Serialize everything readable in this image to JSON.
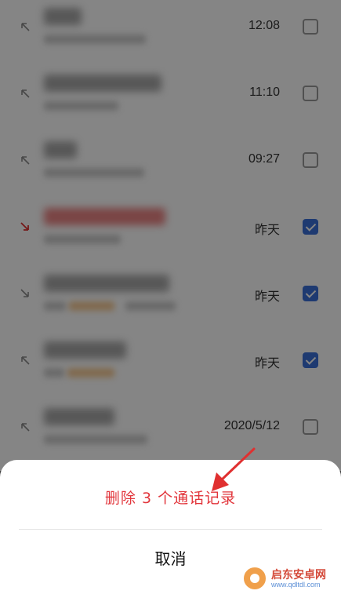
{
  "call_log": {
    "rows": [
      {
        "time": "12:08",
        "direction": "outgoing",
        "checked": false,
        "name_color": "gray"
      },
      {
        "time": "11:10",
        "direction": "outgoing",
        "checked": false,
        "name_color": "gray"
      },
      {
        "time": "09:27",
        "direction": "outgoing",
        "checked": false,
        "name_color": "gray"
      },
      {
        "time": "昨天",
        "direction": "missed",
        "checked": true,
        "name_color": "red"
      },
      {
        "time": "昨天",
        "direction": "incoming",
        "checked": true,
        "name_color": "gray"
      },
      {
        "time": "昨天",
        "direction": "outgoing",
        "checked": true,
        "name_color": "gray"
      },
      {
        "time": "2020/5/12",
        "direction": "outgoing",
        "checked": false,
        "name_color": "gray"
      }
    ]
  },
  "sheet": {
    "delete_label": "删除 3 个通话记录",
    "cancel_label": "取消"
  },
  "watermark": {
    "title": "启东安卓网",
    "url": "www.qdltdl.com"
  },
  "colors": {
    "accent_red": "#e2363c",
    "checkbox_blue": "#3a6fd8",
    "arrow_red": "#e03030"
  },
  "icons": {
    "outgoing": "arrow-up-left-icon",
    "missed": "arrow-down-right-icon",
    "incoming": "arrow-down-right-icon"
  }
}
